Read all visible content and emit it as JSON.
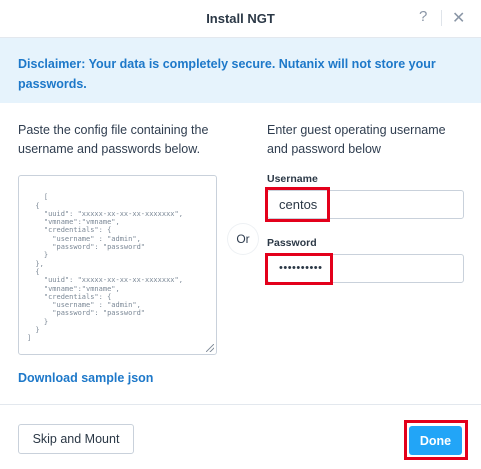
{
  "dialog": {
    "title": "Install NGT",
    "help_icon": "?",
    "close_icon": "✕"
  },
  "disclaimer": "Disclaimer: Your data is completely secure. Nutanix will not store your passwords.",
  "left": {
    "label": "Paste the config file containing the username and passwords below.",
    "config_text": "[\n  {\n    \"uuid\": \"xxxxx-xx-xx-xx-xxxxxxx\",\n    \"vmname\":\"vmname\",\n    \"credentials\": {\n      \"username\" : \"admin\",\n      \"password\": \"password\"\n    }\n  },\n  {\n    \"uuid\": \"xxxxx-xx-xx-xx-xxxxxxx\",\n    \"vmname\":\"vmname\",\n    \"credentials\": {\n      \"username\" : \"admin\",\n      \"password\": \"password\"\n    }\n  }\n]",
    "download_link": "Download sample json"
  },
  "or_label": "Or",
  "right": {
    "label": "Enter guest operating username and password below",
    "username_label": "Username",
    "username_value": "centos",
    "password_label": "Password",
    "password_value": "••••••••••"
  },
  "footer": {
    "skip_label": "Skip and Mount",
    "done_label": "Done"
  },
  "colors": {
    "accent": "#1d78c9",
    "primary_button": "#22a5f7",
    "disclaimer_bg": "#e6f3fc",
    "highlight": "#e3001b"
  }
}
